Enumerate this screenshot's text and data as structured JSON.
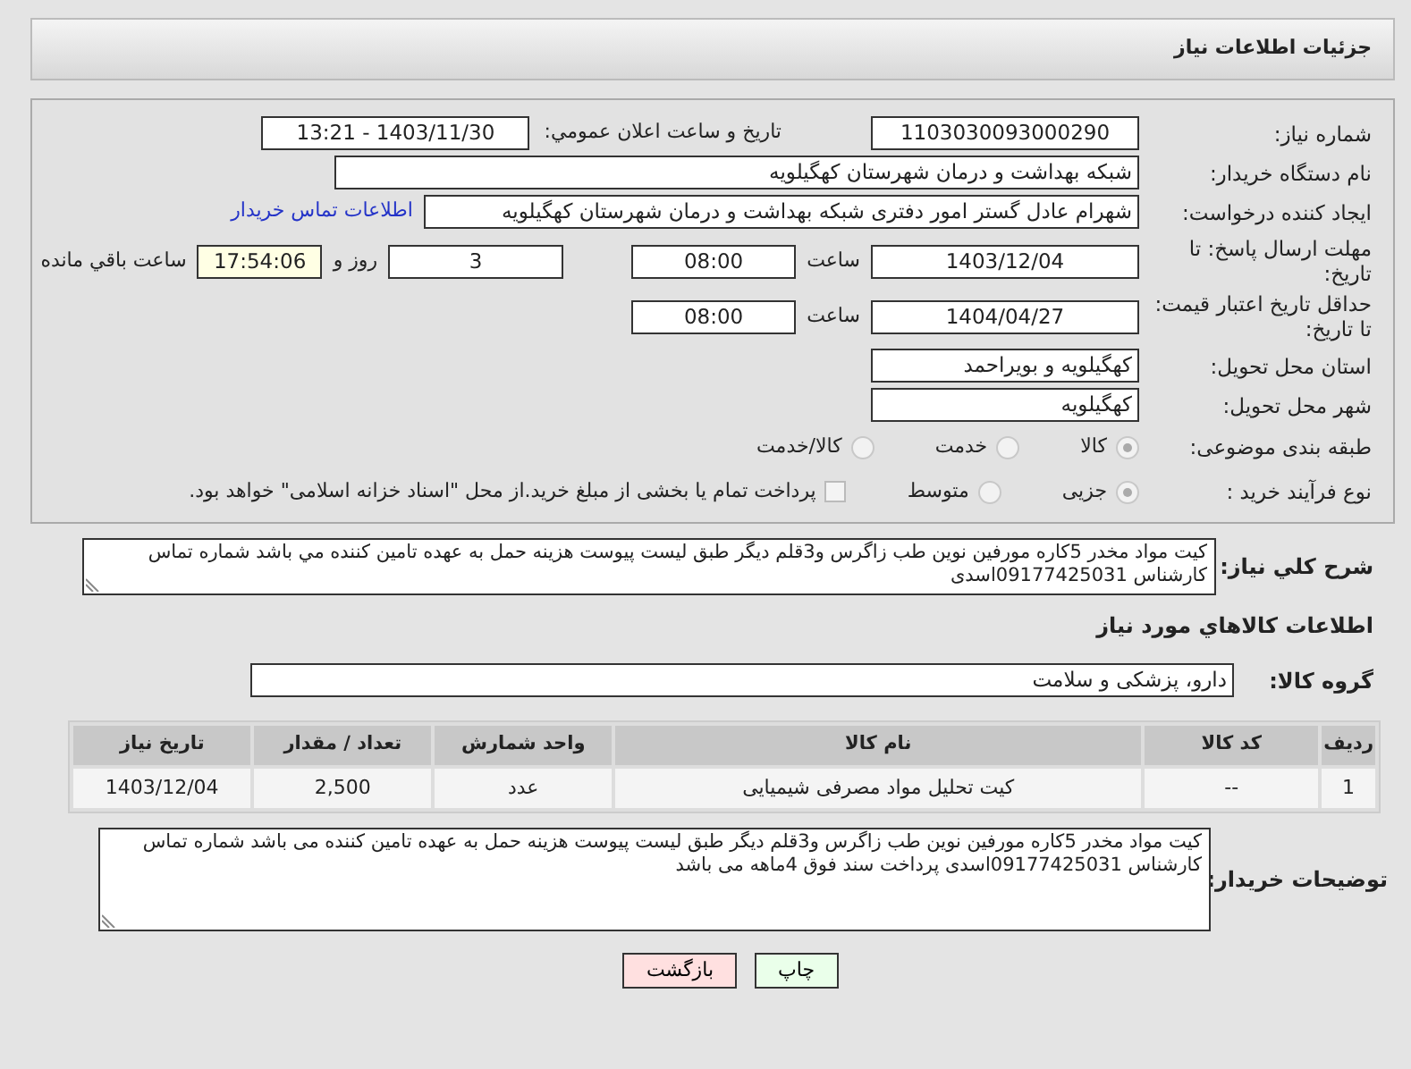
{
  "header": {
    "title": "جزئیات اطلاعات نیاز"
  },
  "need_number": {
    "label": "شماره نیاز:",
    "value": "1103030093000290"
  },
  "announce": {
    "label": "تاریخ و ساعت اعلان عمومي:",
    "value": "1403/11/30 - 13:21"
  },
  "buyer_org": {
    "label": "نام دستگاه خریدار:",
    "value": "شبکه بهداشت و درمان شهرستان کهگیلویه"
  },
  "requester": {
    "label": "ایجاد کننده درخواست:",
    "value": "شهرام عادل گستر امور دفتری شبکه بهداشت و درمان شهرستان کهگیلویه",
    "link": "اطلاعات تماس خریدار"
  },
  "deadline": {
    "label": "مهلت ارسال پاسخ: تا تاریخ:",
    "date": "1403/12/04",
    "time_label": "ساعت",
    "time": "08:00",
    "days": "3",
    "days_label": "روز و",
    "remaining": "17:54:06",
    "remaining_label": "ساعت باقي مانده"
  },
  "validity": {
    "label": "حداقل تاریخ اعتبار قیمت: تا تاریخ:",
    "date": "1404/04/27",
    "time_label": "ساعت",
    "time": "08:00"
  },
  "province": {
    "label": "استان محل تحویل:",
    "value": "کهگیلویه و بویراحمد"
  },
  "city": {
    "label": "شهر محل تحویل:",
    "value": "کهگیلویه"
  },
  "category": {
    "label": "طبقه بندی موضوعی:",
    "options": [
      {
        "label": "کالا",
        "selected": true
      },
      {
        "label": "خدمت",
        "selected": false
      },
      {
        "label": "کالا/خدمت",
        "selected": false
      }
    ]
  },
  "process": {
    "label": "نوع فرآیند خرید :",
    "options": [
      {
        "label": "جزیی",
        "selected": true
      },
      {
        "label": "متوسط",
        "selected": false
      }
    ],
    "payment": {
      "checked": false,
      "text": "پرداخت تمام یا بخشی از مبلغ خرید.از محل \"اسناد خزانه اسلامی\" خواهد بود."
    }
  },
  "description": {
    "label": "شرح کلي نیاز:",
    "value": "کیت مواد مخدر 5کاره مورفین نوین طب زاگرس و3قلم دیگر طبق لیست پیوست هزینه حمل به عهده تامین کننده مي باشد شماره تماس کارشناس 09177425031اسدی"
  },
  "goods_heading": "اطلاعات کالاهاي مورد نیاز",
  "goods_group": {
    "label": "گروه کالا:",
    "value": "دارو، پزشکی و سلامت"
  },
  "table": {
    "columns": [
      "ردیف",
      "کد کالا",
      "نام کالا",
      "واحد شمارش",
      "تعداد / مقدار",
      "تاریخ نیاز"
    ],
    "rows": [
      [
        "1",
        "--",
        "کیت تحلیل مواد مصرفی شیمیایی",
        "عدد",
        "2,500",
        "1403/12/04"
      ]
    ]
  },
  "buyer_notes": {
    "label": "توضیحات خریدار:",
    "value": "کیت مواد مخدر 5کاره مورفین نوین طب زاگرس و3قلم دیگر طبق لیست پیوست هزینه حمل به عهده تامین کننده می باشد شماره تماس کارشناس 09177425031اسدی پرداخت سند فوق 4ماهه می باشد"
  },
  "buttons": [
    {
      "label": "چاپ",
      "kind": "print"
    },
    {
      "label": "بازگشت",
      "kind": "back"
    }
  ]
}
